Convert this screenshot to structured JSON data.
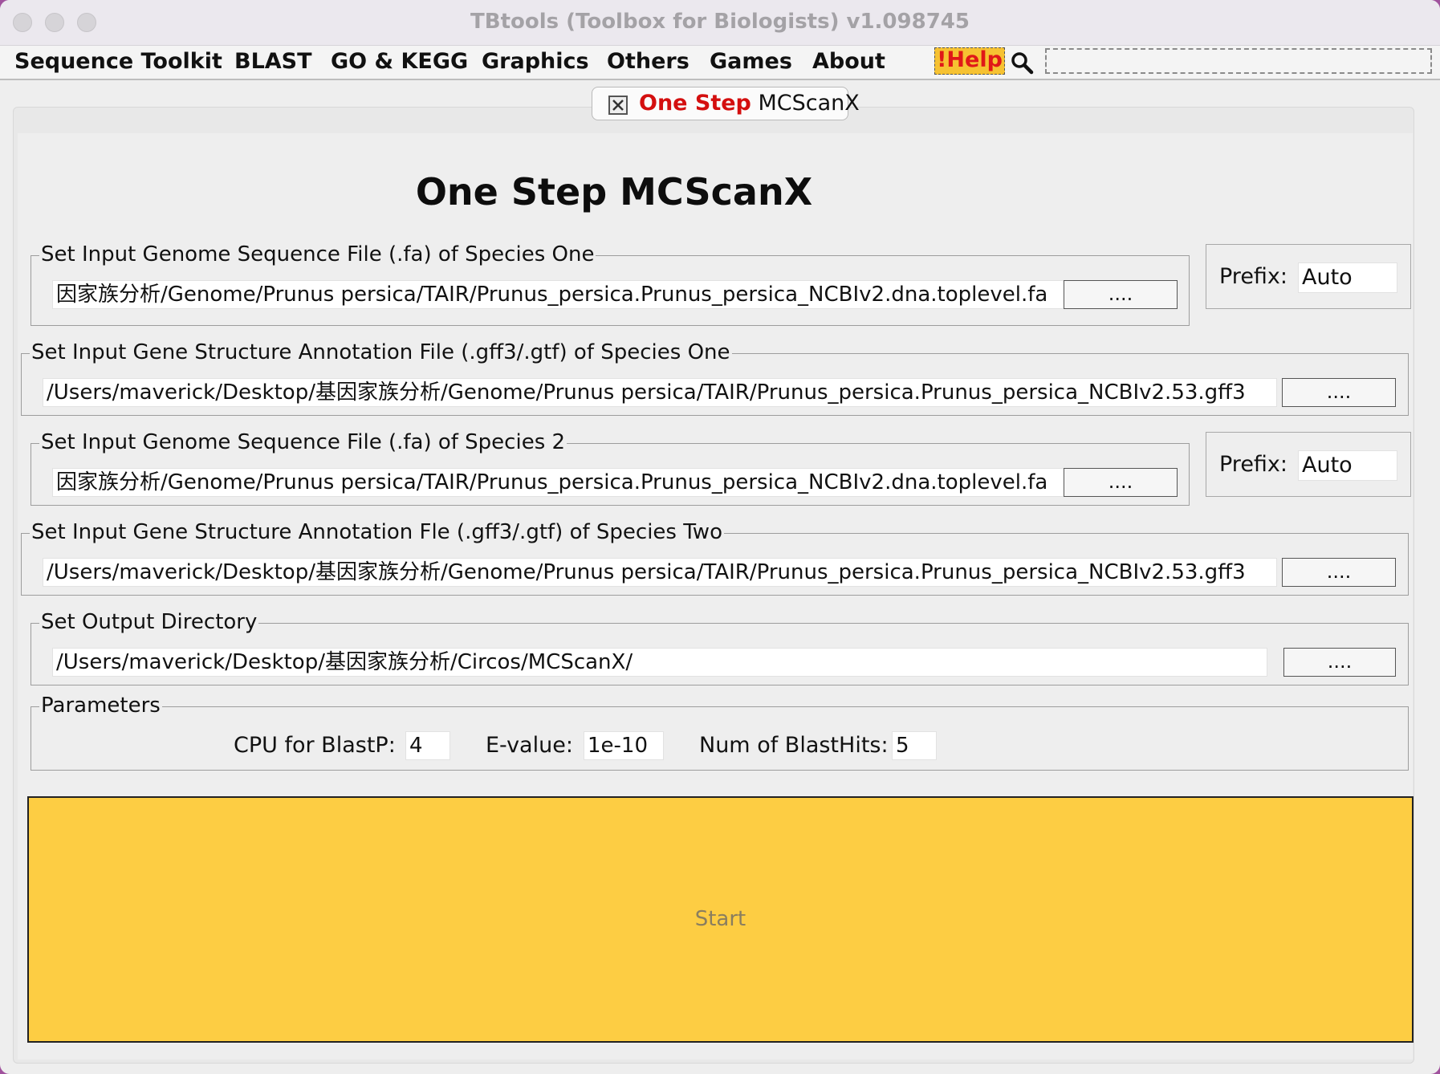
{
  "window": {
    "title": "TBtools (Toolbox for Biologists) v1.098745"
  },
  "menu": {
    "items": [
      "Sequence Toolkit",
      "BLAST",
      "GO & KEGG",
      "Graphics",
      "Others",
      "Games",
      "About"
    ],
    "help_label": "!Help"
  },
  "tab": {
    "highlight": "One Step",
    "rest": "MCScanX"
  },
  "main": {
    "title": "One Step MCScanX"
  },
  "species1_genome": {
    "label": "Set Input Genome Sequence File (.fa) of Species One",
    "value": "因家族分析/Genome/Prunus persica/TAIR/Prunus_persica.Prunus_persica_NCBIv2.dna.toplevel.fa",
    "browse": "...."
  },
  "species1_prefix": {
    "label": "Prefix:",
    "value": "Auto"
  },
  "species1_annotation": {
    "label": "Set Input Gene Structure Annotation File (.gff3/.gtf) of Species One",
    "value": "/Users/maverick/Desktop/基因家族分析/Genome/Prunus persica/TAIR/Prunus_persica.Prunus_persica_NCBIv2.53.gff3",
    "browse": "...."
  },
  "species2_genome": {
    "label": "Set Input Genome Sequence File (.fa) of Species 2",
    "value": "因家族分析/Genome/Prunus persica/TAIR/Prunus_persica.Prunus_persica_NCBIv2.dna.toplevel.fa",
    "browse": "...."
  },
  "species2_prefix": {
    "label": "Prefix:",
    "value": "Auto"
  },
  "species2_annotation": {
    "label": "Set Input Gene Structure Annotation Fle (.gff3/.gtf) of Species Two",
    "value": "/Users/maverick/Desktop/基因家族分析/Genome/Prunus persica/TAIR/Prunus_persica.Prunus_persica_NCBIv2.53.gff3",
    "browse": "...."
  },
  "output": {
    "label": "Set Output Directory",
    "value": "/Users/maverick/Desktop/基因家族分析/Circos/MCScanX/",
    "browse": "...."
  },
  "parameters": {
    "label": "Parameters",
    "cpu_label": "CPU for BlastP:",
    "cpu_value": "4",
    "evalue_label": "E-value:",
    "evalue_value": "1e-10",
    "hits_label": "Num of BlastHits:",
    "hits_value": "5"
  },
  "start": {
    "label": "Start",
    "color": "#fdcd43"
  }
}
